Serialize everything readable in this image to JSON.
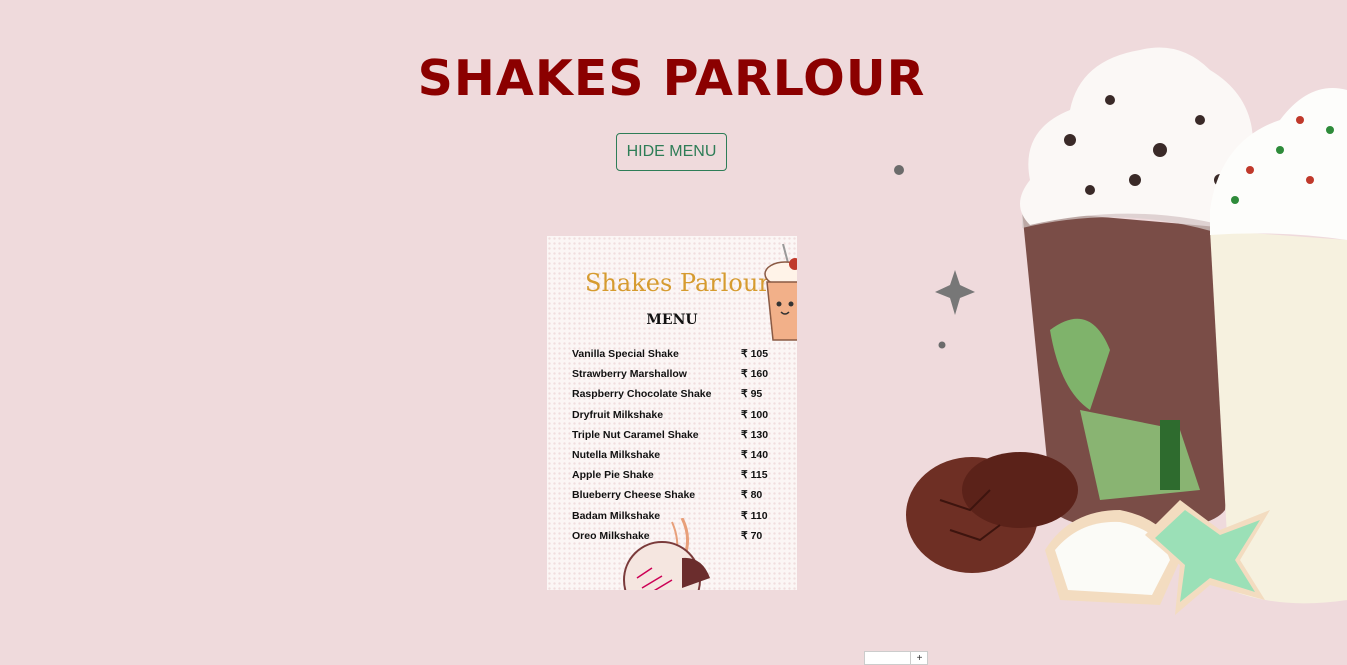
{
  "page": {
    "title": "SHAKES PARLOUR"
  },
  "toggle": {
    "label": "HIDE MENU"
  },
  "menu": {
    "heading": "Shakes Parlour",
    "subheading": "MENU",
    "items": [
      {
        "name": "Vanilla Special Shake",
        "price": "₹ 105"
      },
      {
        "name": "Strawberry Marshallow",
        "price": "₹ 160"
      },
      {
        "name": "Raspberry Chocolate Shake",
        "price": "₹ 95"
      },
      {
        "name": "Dryfruit Milkshake",
        "price": "₹ 100"
      },
      {
        "name": "Triple Nut Caramel Shake",
        "price": "₹ 130"
      },
      {
        "name": "Nutella Milkshake",
        "price": "₹ 140"
      },
      {
        "name": "Apple Pie Shake",
        "price": "₹ 115"
      },
      {
        "name": "Blueberry Cheese Shake",
        "price": "₹ 80"
      },
      {
        "name": "Badam Milkshake",
        "price": "₹ 110"
      },
      {
        "name": "Oreo Milkshake",
        "price": "₹ 70"
      }
    ]
  },
  "stepper": {
    "plus_label": "+",
    "value": ""
  },
  "colors": {
    "background": "#efdadc",
    "title": "#8b0000",
    "button": "#2e7d57",
    "menu_heading": "#d69b2f"
  },
  "icons": {
    "hero": "milkshake-cookies-illustration",
    "cup": "milkshake-cup-icon",
    "bowl": "shake-bowl-icon"
  }
}
